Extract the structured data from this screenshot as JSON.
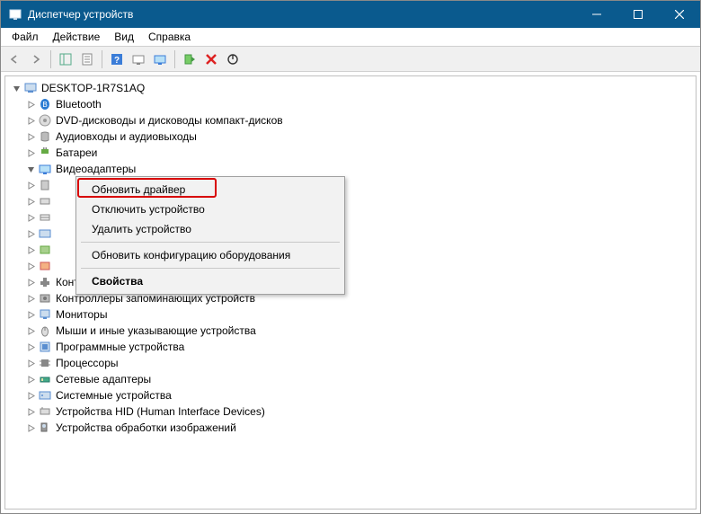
{
  "window": {
    "title": "Диспетчер устройств"
  },
  "menubar": {
    "file": "Файл",
    "action": "Действие",
    "view": "Вид",
    "help": "Справка"
  },
  "tree": {
    "root": "DESKTOP-1R7S1AQ",
    "items": [
      {
        "label": "Bluetooth",
        "caret": ">"
      },
      {
        "label": "DVD-дисководы и дисководы компакт-дисков",
        "caret": ">"
      },
      {
        "label": "Аудиовходы и аудиовыходы",
        "caret": ">"
      },
      {
        "label": "Батареи",
        "caret": ">"
      },
      {
        "label": "Видеоадаптеры",
        "caret": "v"
      },
      {
        "label": "",
        "caret": ">"
      },
      {
        "label": "",
        "caret": ">"
      },
      {
        "label": "",
        "caret": ">"
      },
      {
        "label": "",
        "caret": ">"
      },
      {
        "label": "",
        "caret": ">"
      },
      {
        "label": "",
        "caret": ">"
      },
      {
        "label": "Контроллеры USB",
        "caret": ">"
      },
      {
        "label": "Контроллеры запоминающих устройств",
        "caret": ">"
      },
      {
        "label": "Мониторы",
        "caret": ">"
      },
      {
        "label": "Мыши и иные указывающие устройства",
        "caret": ">"
      },
      {
        "label": "Программные устройства",
        "caret": ">"
      },
      {
        "label": "Процессоры",
        "caret": ">"
      },
      {
        "label": "Сетевые адаптеры",
        "caret": ">"
      },
      {
        "label": "Системные устройства",
        "caret": ">"
      },
      {
        "label": "Устройства HID (Human Interface Devices)",
        "caret": ">"
      },
      {
        "label": "Устройства обработки изображений",
        "caret": ">"
      }
    ]
  },
  "context_menu": {
    "update_driver": "Обновить драйвер",
    "disable": "Отключить устройство",
    "delete": "Удалить устройство",
    "scan": "Обновить конфигурацию оборудования",
    "properties": "Свойства"
  }
}
